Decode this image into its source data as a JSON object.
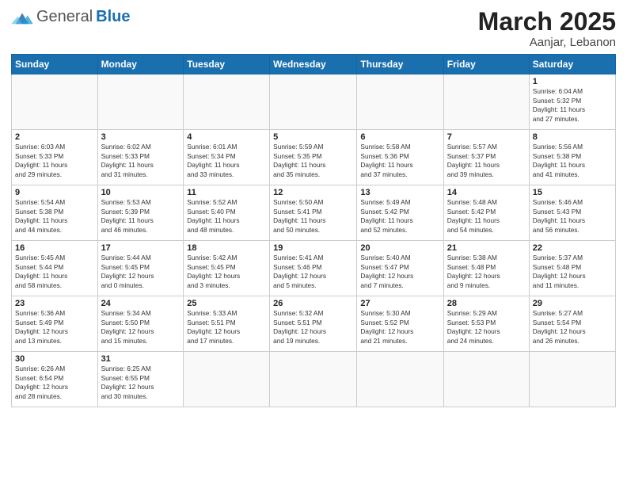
{
  "header": {
    "logo_general": "General",
    "logo_blue": "Blue",
    "month": "March 2025",
    "location": "Aanjar, Lebanon"
  },
  "weekdays": [
    "Sunday",
    "Monday",
    "Tuesday",
    "Wednesday",
    "Thursday",
    "Friday",
    "Saturday"
  ],
  "weeks": [
    [
      {
        "day": "",
        "info": ""
      },
      {
        "day": "",
        "info": ""
      },
      {
        "day": "",
        "info": ""
      },
      {
        "day": "",
        "info": ""
      },
      {
        "day": "",
        "info": ""
      },
      {
        "day": "",
        "info": ""
      },
      {
        "day": "1",
        "info": "Sunrise: 6:04 AM\nSunset: 5:32 PM\nDaylight: 11 hours\nand 27 minutes."
      }
    ],
    [
      {
        "day": "2",
        "info": "Sunrise: 6:03 AM\nSunset: 5:33 PM\nDaylight: 11 hours\nand 29 minutes."
      },
      {
        "day": "3",
        "info": "Sunrise: 6:02 AM\nSunset: 5:33 PM\nDaylight: 11 hours\nand 31 minutes."
      },
      {
        "day": "4",
        "info": "Sunrise: 6:01 AM\nSunset: 5:34 PM\nDaylight: 11 hours\nand 33 minutes."
      },
      {
        "day": "5",
        "info": "Sunrise: 5:59 AM\nSunset: 5:35 PM\nDaylight: 11 hours\nand 35 minutes."
      },
      {
        "day": "6",
        "info": "Sunrise: 5:58 AM\nSunset: 5:36 PM\nDaylight: 11 hours\nand 37 minutes."
      },
      {
        "day": "7",
        "info": "Sunrise: 5:57 AM\nSunset: 5:37 PM\nDaylight: 11 hours\nand 39 minutes."
      },
      {
        "day": "8",
        "info": "Sunrise: 5:56 AM\nSunset: 5:38 PM\nDaylight: 11 hours\nand 41 minutes."
      }
    ],
    [
      {
        "day": "9",
        "info": "Sunrise: 5:54 AM\nSunset: 5:38 PM\nDaylight: 11 hours\nand 44 minutes."
      },
      {
        "day": "10",
        "info": "Sunrise: 5:53 AM\nSunset: 5:39 PM\nDaylight: 11 hours\nand 46 minutes."
      },
      {
        "day": "11",
        "info": "Sunrise: 5:52 AM\nSunset: 5:40 PM\nDaylight: 11 hours\nand 48 minutes."
      },
      {
        "day": "12",
        "info": "Sunrise: 5:50 AM\nSunset: 5:41 PM\nDaylight: 11 hours\nand 50 minutes."
      },
      {
        "day": "13",
        "info": "Sunrise: 5:49 AM\nSunset: 5:42 PM\nDaylight: 11 hours\nand 52 minutes."
      },
      {
        "day": "14",
        "info": "Sunrise: 5:48 AM\nSunset: 5:42 PM\nDaylight: 11 hours\nand 54 minutes."
      },
      {
        "day": "15",
        "info": "Sunrise: 5:46 AM\nSunset: 5:43 PM\nDaylight: 11 hours\nand 56 minutes."
      }
    ],
    [
      {
        "day": "16",
        "info": "Sunrise: 5:45 AM\nSunset: 5:44 PM\nDaylight: 11 hours\nand 58 minutes."
      },
      {
        "day": "17",
        "info": "Sunrise: 5:44 AM\nSunset: 5:45 PM\nDaylight: 12 hours\nand 0 minutes."
      },
      {
        "day": "18",
        "info": "Sunrise: 5:42 AM\nSunset: 5:45 PM\nDaylight: 12 hours\nand 3 minutes."
      },
      {
        "day": "19",
        "info": "Sunrise: 5:41 AM\nSunset: 5:46 PM\nDaylight: 12 hours\nand 5 minutes."
      },
      {
        "day": "20",
        "info": "Sunrise: 5:40 AM\nSunset: 5:47 PM\nDaylight: 12 hours\nand 7 minutes."
      },
      {
        "day": "21",
        "info": "Sunrise: 5:38 AM\nSunset: 5:48 PM\nDaylight: 12 hours\nand 9 minutes."
      },
      {
        "day": "22",
        "info": "Sunrise: 5:37 AM\nSunset: 5:48 PM\nDaylight: 12 hours\nand 11 minutes."
      }
    ],
    [
      {
        "day": "23",
        "info": "Sunrise: 5:36 AM\nSunset: 5:49 PM\nDaylight: 12 hours\nand 13 minutes."
      },
      {
        "day": "24",
        "info": "Sunrise: 5:34 AM\nSunset: 5:50 PM\nDaylight: 12 hours\nand 15 minutes."
      },
      {
        "day": "25",
        "info": "Sunrise: 5:33 AM\nSunset: 5:51 PM\nDaylight: 12 hours\nand 17 minutes."
      },
      {
        "day": "26",
        "info": "Sunrise: 5:32 AM\nSunset: 5:51 PM\nDaylight: 12 hours\nand 19 minutes."
      },
      {
        "day": "27",
        "info": "Sunrise: 5:30 AM\nSunset: 5:52 PM\nDaylight: 12 hours\nand 21 minutes."
      },
      {
        "day": "28",
        "info": "Sunrise: 5:29 AM\nSunset: 5:53 PM\nDaylight: 12 hours\nand 24 minutes."
      },
      {
        "day": "29",
        "info": "Sunrise: 5:27 AM\nSunset: 5:54 PM\nDaylight: 12 hours\nand 26 minutes."
      }
    ],
    [
      {
        "day": "30",
        "info": "Sunrise: 6:26 AM\nSunset: 6:54 PM\nDaylight: 12 hours\nand 28 minutes."
      },
      {
        "day": "31",
        "info": "Sunrise: 6:25 AM\nSunset: 6:55 PM\nDaylight: 12 hours\nand 30 minutes."
      },
      {
        "day": "",
        "info": ""
      },
      {
        "day": "",
        "info": ""
      },
      {
        "day": "",
        "info": ""
      },
      {
        "day": "",
        "info": ""
      },
      {
        "day": "",
        "info": ""
      }
    ]
  ]
}
